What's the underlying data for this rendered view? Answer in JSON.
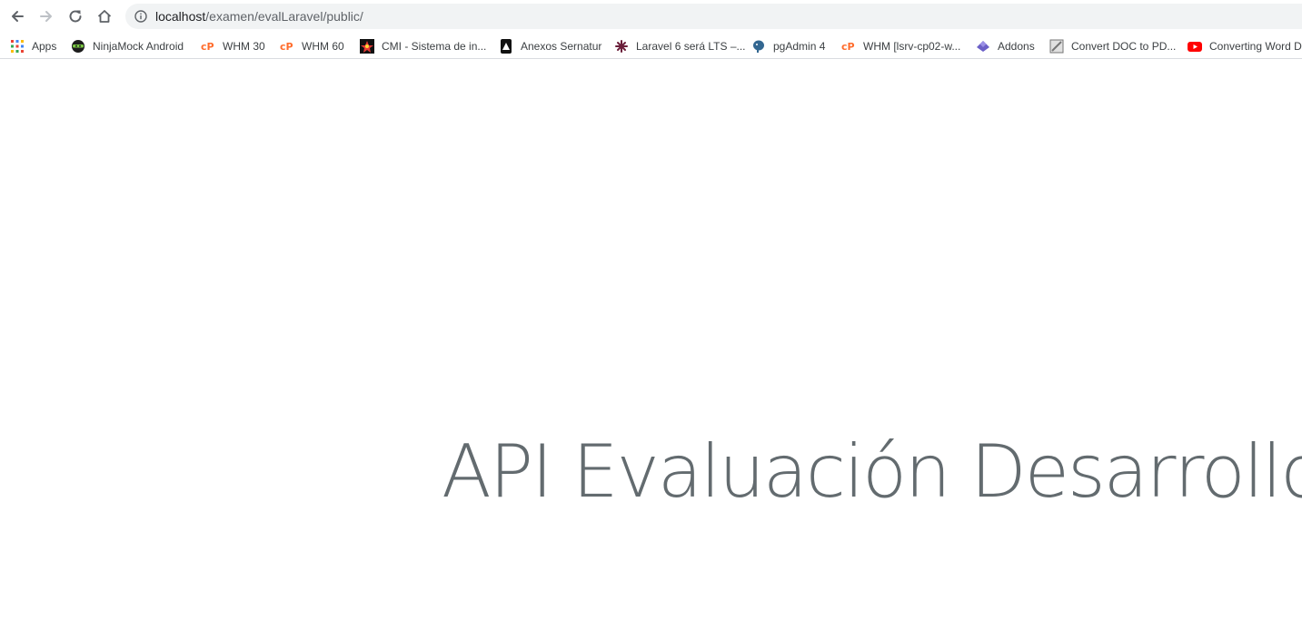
{
  "browser": {
    "address_bar": {
      "host": "localhost",
      "path": "/examen/evalLaravel/public/"
    }
  },
  "bookmarks": [
    {
      "label": "Apps",
      "icon": "apps-grid-icon"
    },
    {
      "label": "NinjaMock Android",
      "icon": "ninjamock-icon"
    },
    {
      "label": "WHM 30",
      "icon": "cpanel-icon"
    },
    {
      "label": "WHM 60",
      "icon": "cpanel-icon"
    },
    {
      "label": "CMI - Sistema de in...",
      "icon": "cmi-icon"
    },
    {
      "label": "Anexos Sernatur",
      "icon": "sernatur-icon"
    },
    {
      "label": "Laravel 6 será LTS –...",
      "icon": "laravel-icon"
    },
    {
      "label": "pgAdmin 4",
      "icon": "pgadmin-icon"
    },
    {
      "label": "WHM [lsrv-cp02-w...",
      "icon": "cpanel-icon"
    },
    {
      "label": "Addons",
      "icon": "addons-icon"
    },
    {
      "label": "Convert DOC to PD...",
      "icon": "convert-doc-icon"
    },
    {
      "label": "Converting Word D",
      "icon": "youtube-icon"
    }
  ],
  "page": {
    "title": "API Evaluación Desarrollo"
  },
  "colors": {
    "title": "#636b6f",
    "cpanel": "#ff6c2c",
    "youtube": "#ff0000",
    "addons": "#6b5fc7"
  }
}
